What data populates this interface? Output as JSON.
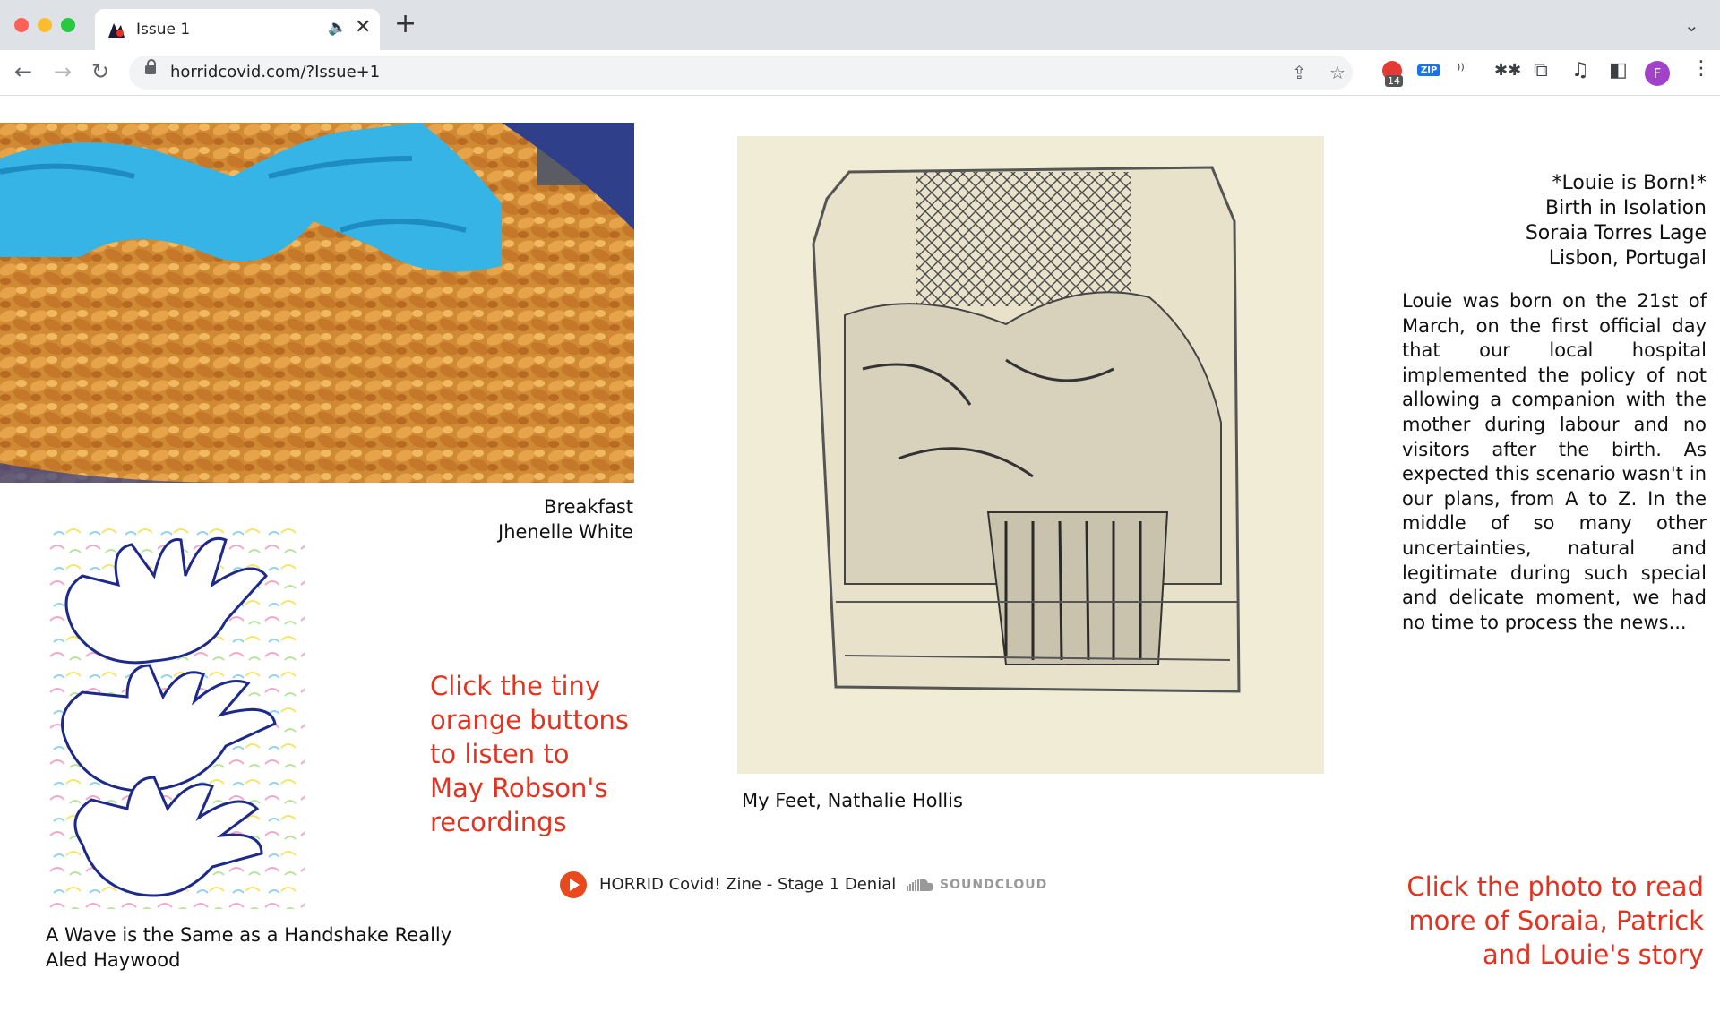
{
  "browser": {
    "tab_title": "Issue 1",
    "url": "horridcovid.com/?Issue+1",
    "extension_badge_count": "14",
    "extension_zip_label": "ZIP",
    "profile_initial": "F"
  },
  "artworks": {
    "breakfast": {
      "title": "Breakfast",
      "artist": "Jhenelle White"
    },
    "wave": {
      "title": "A Wave is the Same as a Handshake Really",
      "artist": "Aled Haywood"
    },
    "feet": {
      "caption": "My Feet, Nathalie Hollis"
    }
  },
  "notes": {
    "listen": [
      "Click the tiny",
      "orange buttons",
      "to listen to",
      "May Robson's",
      "recordings"
    ],
    "read_more": [
      "Click the photo to read",
      "more of Soraia, Patrick",
      "and Louie's story"
    ]
  },
  "story": {
    "heading": [
      "*Louie is Born!*",
      "Birth in Isolation",
      "Soraia Torres Lage",
      "Lisbon, Portugal"
    ],
    "body": "Louie was born on the 21st of March, on the first official day that our local hospital implemented the policy of not allowing a companion with the mother during labour and no visitors after the birth. As expected this scenario wasn't in our plans, from A to Z. In the middle of so many other uncertainties, natural and legitimate during such special and delicate moment, we had no time to process the news..."
  },
  "player": {
    "track_title": "HORRID Covid! Zine - Stage 1 Denial",
    "service": "SOUNDCLOUD"
  },
  "colors": {
    "accent_red": "#e3321f",
    "play_orange": "#e8491d"
  }
}
